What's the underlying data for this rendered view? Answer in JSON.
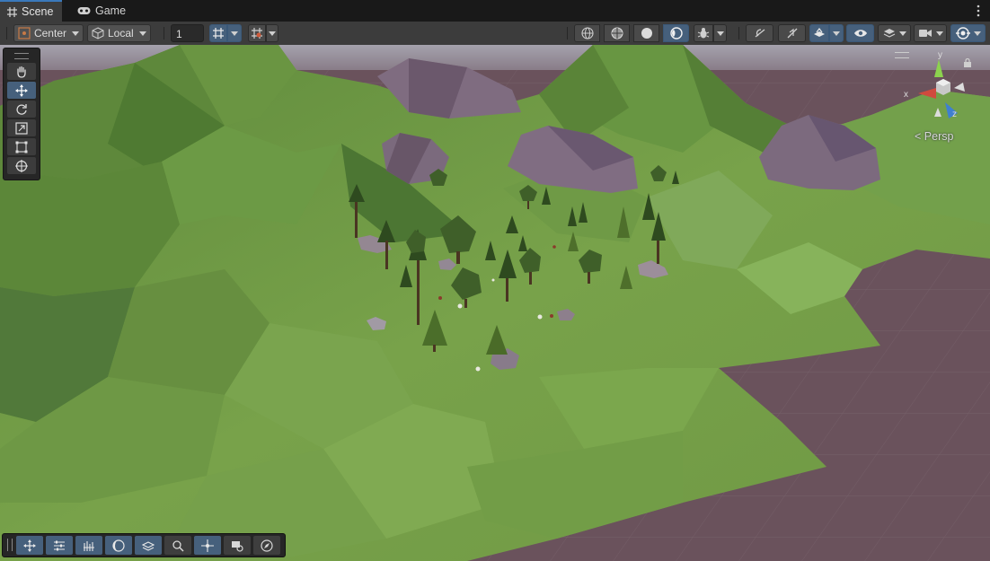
{
  "tabs": [
    {
      "label": "Scene",
      "icon": "grid-icon",
      "active": true
    },
    {
      "label": "Game",
      "icon": "gamepad-icon",
      "active": false
    }
  ],
  "toolbar": {
    "pivot_mode": "Center",
    "pivot_rotation": "Local",
    "grid_snap_value": "1"
  },
  "viewport": {
    "projection_label": "Persp",
    "gizmo_axes": {
      "x": "x",
      "y": "y",
      "z": "z"
    }
  },
  "colors": {
    "accent": "#46607c",
    "grass": "#6f9a45",
    "ground": "#6a525c",
    "rock": "#7e6c7e",
    "sky": "#8e8a95"
  }
}
